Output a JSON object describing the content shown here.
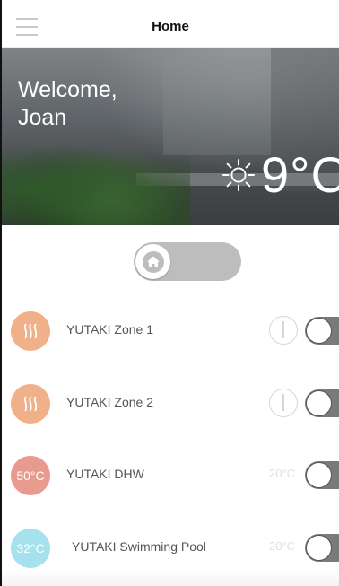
{
  "header": {
    "title": "Home",
    "menu_icon": "hamburger-menu-icon"
  },
  "hero": {
    "greeting_line1": "Welcome,",
    "greeting_line2": "Joan",
    "weather_icon": "sun-icon",
    "temperature": "9°C"
  },
  "mode_toggle": {
    "icon": "home-icon",
    "state": "home"
  },
  "zones": [
    {
      "name": "YUTAKI Zone 1",
      "icon": "heating-icon",
      "icon_color": "#f0b089",
      "power_icon": "power-icon",
      "switch_on": false
    },
    {
      "name": "YUTAKI Zone 2",
      "icon": "heating-icon",
      "icon_color": "#f0b089",
      "power_icon": "power-icon",
      "switch_on": false
    },
    {
      "name": "YUTAKI DHW",
      "icon_text": "50°C",
      "icon_color": "#e89a8f",
      "setpoint": "20°C",
      "switch_on": false
    },
    {
      "name": "YUTAKI Swimming Pool",
      "icon_text": "32°C",
      "icon_color": "#a6e1ee",
      "setpoint": "20°C",
      "switch_on": false
    }
  ],
  "colors": {
    "header_bg": "#ffffff",
    "toggle_track": "#bdbdbd",
    "switch_track": "#7a7a7a"
  }
}
